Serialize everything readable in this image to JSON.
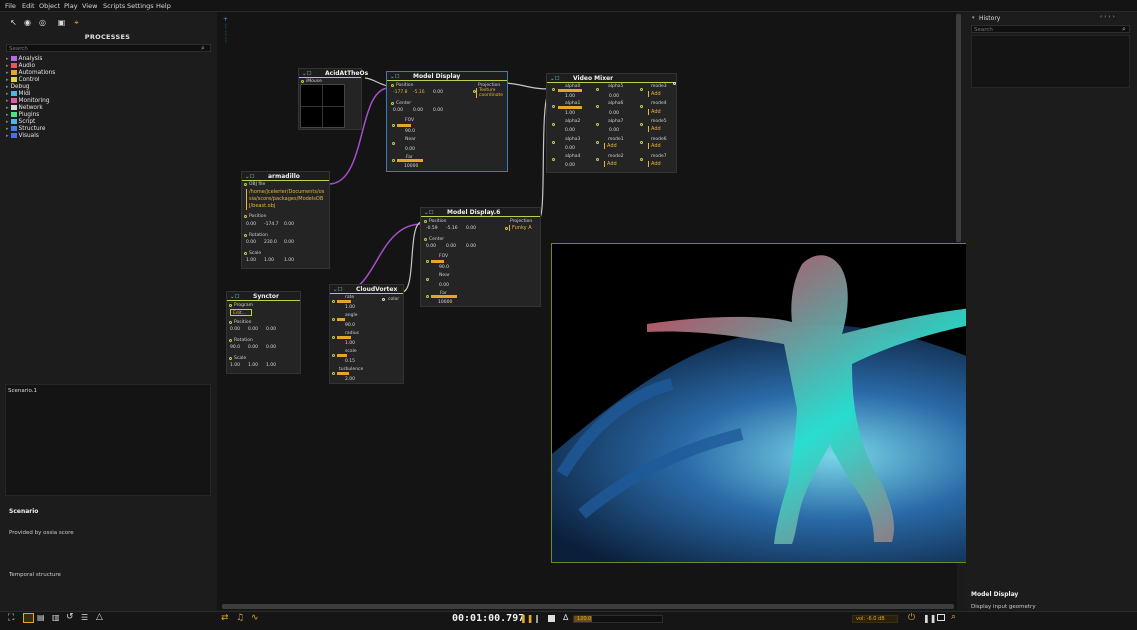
{
  "menu": [
    "File",
    "Edit",
    "Object",
    "Play",
    "View",
    "Scripts",
    "Settings",
    "Help"
  ],
  "left": {
    "title": "PROCESSES",
    "search_placeholder": "Search",
    "tree": [
      {
        "label": "Analysis",
        "color": "#b46adf"
      },
      {
        "label": "Audio",
        "color": "#e35a5a"
      },
      {
        "label": "Automations",
        "color": "#e8a33a"
      },
      {
        "label": "Control",
        "color": "#e3d24a"
      },
      {
        "label": "Debug",
        "color": ""
      },
      {
        "label": "Midi",
        "color": "#4ab8e3"
      },
      {
        "label": "Monitoring",
        "color": "#e35aa8"
      },
      {
        "label": "Network",
        "color": "#d9d9d9"
      },
      {
        "label": "Plugins",
        "color": "#4ae38a"
      },
      {
        "label": "Script",
        "color": "#4ab8e3"
      },
      {
        "label": "Structure",
        "color": "#4a7be3"
      },
      {
        "label": "Visuals",
        "color": "#4a6ee3"
      }
    ],
    "scenario_tab": "Scenario.1",
    "info_title": "Scenario",
    "info_provided": "Provided by ossia score",
    "info_temporal": "Temporal structure"
  },
  "nodes": {
    "acid": {
      "title": "AcidAtTheOs",
      "port": "iMouse"
    },
    "model1": {
      "title": "Model Display",
      "position": "Position",
      "pos_vals": [
        "-177.8",
        "-5.16",
        "0.00"
      ],
      "projection": "Projection",
      "proj_val": "Texture coordinate",
      "center": "Center",
      "center_vals": [
        "0.00",
        "0.00",
        "0.00"
      ],
      "fov": "FOV",
      "fov_val": "90.0",
      "near": "Near",
      "near_val": "0.00",
      "far": "Far",
      "far_val": "10000"
    },
    "mixer": {
      "title": "Video Mixer",
      "alpha": [
        "alpha0",
        "alpha1",
        "alpha2",
        "alpha3",
        "alpha4",
        "alpha5",
        "alpha6",
        "alpha7",
        "alpha8"
      ],
      "alpha_vals": [
        "1.00",
        "1.00",
        "0.00",
        "0.00",
        "0.00",
        "0.00",
        "0.00",
        "0.00"
      ],
      "mode": [
        "mode3",
        "mode4",
        "mode5",
        "mode1",
        "mode2",
        "mode6",
        "mode7"
      ],
      "add": "Add"
    },
    "armadillo": {
      "title": "armadillo",
      "file_label": "OBJ file",
      "file_path": "/home/jcelerier/Documents/ossia/score/packages/ModelsOBJ/beast.obj",
      "position": "Position",
      "pos_vals": [
        "0.00",
        "-174.7",
        "0.00"
      ],
      "rotation": "Rotation",
      "rot_vals": [
        "0.00",
        "230.0",
        "0.00"
      ],
      "scale": "Scale",
      "scale_vals": [
        "1.00",
        "1.00",
        "1.00"
      ]
    },
    "model2": {
      "title": "Model Display.6",
      "position": "Position",
      "pos_vals": [
        "-0.59",
        "-5.16",
        "0.00"
      ],
      "projection": "Projection",
      "proj_val": "Funky A",
      "center": "Center",
      "center_vals": [
        "0.00",
        "0.00",
        "0.00"
      ],
      "fov": "FOV",
      "fov_val": "90.0",
      "near": "Near",
      "near_val": "0.00",
      "far": "Far",
      "far_val": "10000"
    },
    "synctor": {
      "title": "Synctor",
      "program": "Program",
      "edit": "Edit...",
      "position": "Position",
      "pos_vals": [
        "0.00",
        "0.00",
        "0.00"
      ],
      "rotation": "Rotation",
      "rot_vals": [
        "90.0",
        "0.00",
        "0.00"
      ],
      "scale": "Scale",
      "scale_vals": [
        "1.00",
        "1.00",
        "1.00"
      ]
    },
    "cloud": {
      "title": "CloudVortex",
      "out": "color",
      "params": [
        {
          "n": "rate",
          "v": "1.00"
        },
        {
          "n": "angle",
          "v": "90.0"
        },
        {
          "n": "radius",
          "v": "1.00"
        },
        {
          "n": "scale",
          "v": "0.15"
        },
        {
          "n": "turbulence",
          "v": "2.00"
        }
      ]
    }
  },
  "right": {
    "history_title": "History",
    "search_placeholder": "Search",
    "info_title": "Model Display",
    "info_desc": "Display input geometry"
  },
  "bottom": {
    "time": "00:01:00.797",
    "tempo": "120.0",
    "volume": "vol: -6.0 dB"
  },
  "colors": {
    "accent": "#e3a52b",
    "port": "#b8d24a",
    "cable": "#a54fc9"
  }
}
